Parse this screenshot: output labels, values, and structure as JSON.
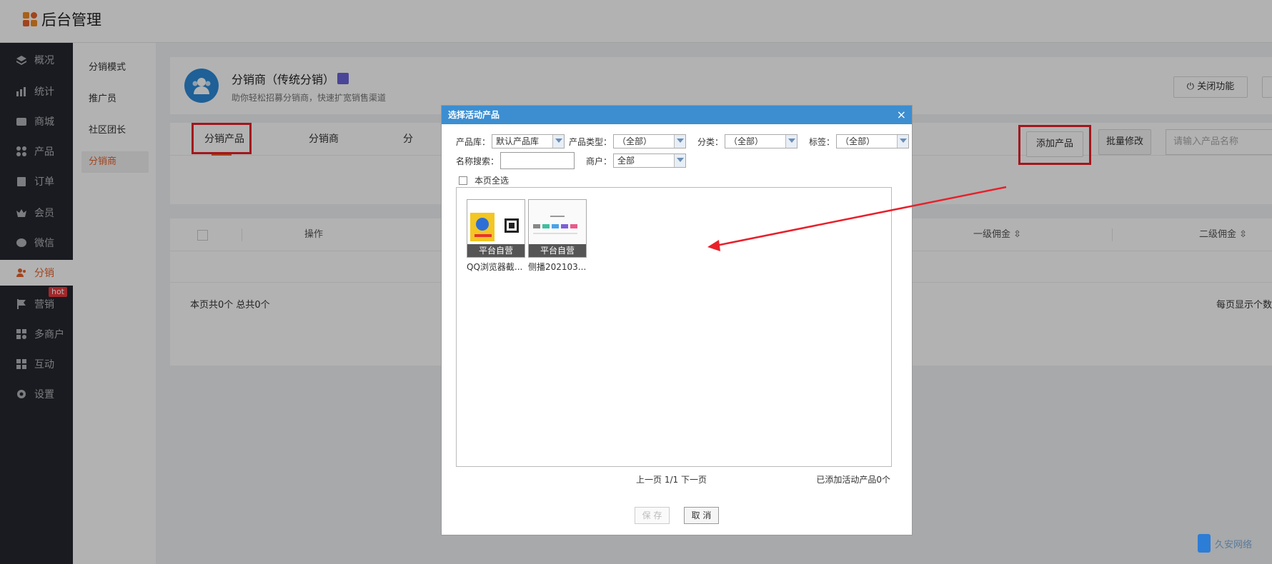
{
  "app": {
    "title": "后台管理"
  },
  "nav": {
    "items": [
      {
        "label": "概况",
        "icon": "layers-icon"
      },
      {
        "label": "统计",
        "icon": "chart-icon"
      },
      {
        "label": "商城",
        "icon": "store-icon"
      },
      {
        "label": "产品",
        "icon": "grid-icon"
      },
      {
        "label": "订单",
        "icon": "clipboard-icon"
      },
      {
        "label": "会员",
        "icon": "crown-icon"
      },
      {
        "label": "微信",
        "icon": "wechat-icon"
      },
      {
        "label": "分销",
        "icon": "users-icon"
      },
      {
        "label": "营销",
        "icon": "flag-icon"
      },
      {
        "label": "多商户",
        "icon": "shop-icon"
      },
      {
        "label": "互动",
        "icon": "interact-icon"
      },
      {
        "label": "设置",
        "icon": "gear-icon"
      }
    ],
    "hot_badge": "hot"
  },
  "subnav": {
    "items": [
      "分销模式",
      "推广员",
      "社区团长",
      "分销商"
    ]
  },
  "feature": {
    "title": "分销商（传统分销）",
    "desc": "助你轻松招募分销商，快速扩宽销售渠道",
    "power_label": "关闭功能"
  },
  "tabs": [
    "分销产品",
    "分销商",
    "分"
  ],
  "toolbar": {
    "add_label": "添加产品",
    "batch_label": "批量修改",
    "search_placeholder": "请输入产品名称"
  },
  "table": {
    "columns": [
      "操作",
      "一级佣金",
      "二级佣金"
    ],
    "page_info": "本页共0个    总共0个",
    "page_size": "每页显示个数"
  },
  "modal": {
    "title": "选择活动产品",
    "close": "×",
    "filters": {
      "lib_label": "产品库：",
      "lib_value": "默认产品库",
      "type_label": "产品类型：",
      "type_value": "（全部）",
      "cat_label": "分类：",
      "cat_value": "（全部）",
      "tag_label": "标签：",
      "tag_value": "（全部）",
      "name_label": "名称搜索：",
      "merchant_label": "商户：",
      "merchant_value": "全部"
    },
    "select_all": "本页全选",
    "products": [
      {
        "name": "QQ浏览器截...",
        "tag": "平台自营"
      },
      {
        "name": "侧播202103...",
        "tag": "平台自营"
      }
    ],
    "pager": "上一页 1/1 下一页",
    "added_count": "已添加活动产品0个",
    "save_label": "保 存",
    "cancel_label": "取 消"
  },
  "watermark": {
    "text": "久安网络"
  },
  "colors": {
    "accent": "#e8622c",
    "highlight": "#e8202a",
    "modal_header": "#3c8ed0",
    "sidebar": "#26282e"
  }
}
